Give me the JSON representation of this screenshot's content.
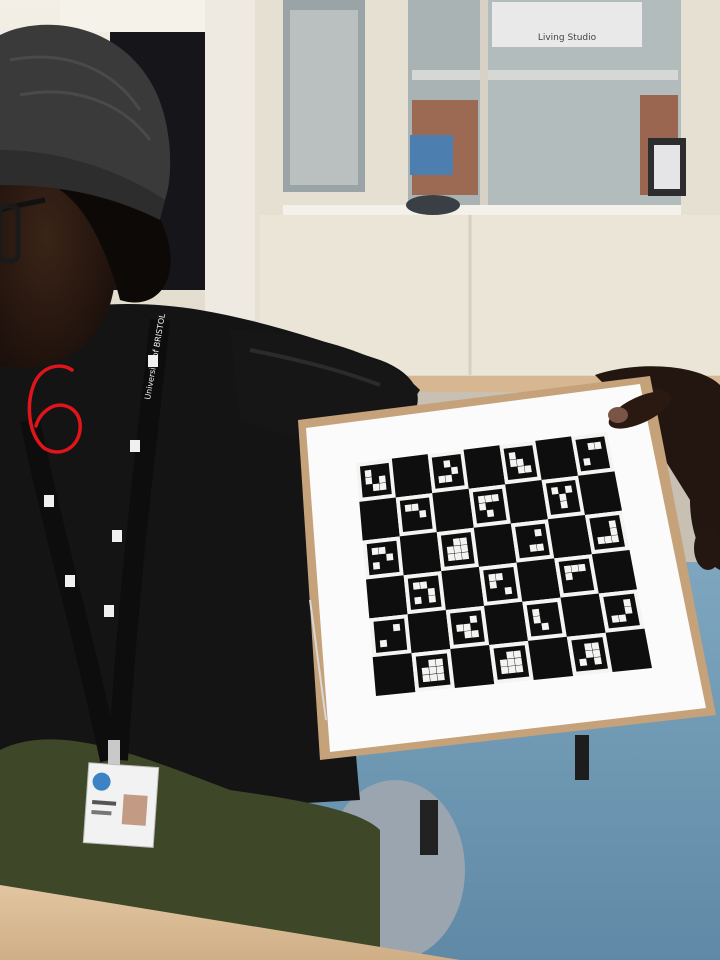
{
  "annotation": {
    "number_label": "6",
    "label_color": "#e0141b"
  },
  "background_signs": {
    "sign_text": "Living Studio"
  },
  "board": {
    "rows": 6,
    "cols": 7,
    "dark_color": "#0e0e0e",
    "light_color": "#f4f4f2"
  },
  "lanyard": {
    "text": "University of BRISTOL"
  },
  "colors": {
    "floor": "#6f98b4",
    "wall": "#e9e4d8",
    "desk": "#d8b995",
    "jacket": "#151515",
    "trousers": "#3f4a2a",
    "hat": "#3a3a3a",
    "cardboard": "#c6a27a"
  }
}
